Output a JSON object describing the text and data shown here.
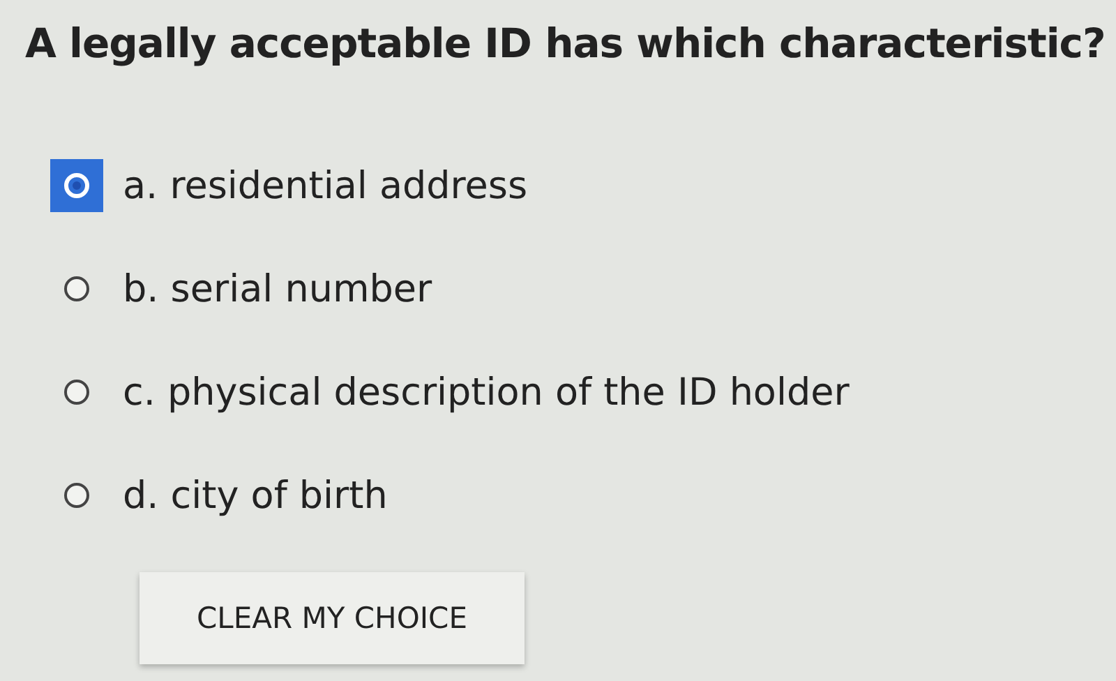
{
  "question": "A legally acceptable ID has which characteristic?",
  "options": [
    {
      "label": "a. residential address",
      "selected": true
    },
    {
      "label": "b. serial number",
      "selected": false
    },
    {
      "label": "c. physical description of the ID holder",
      "selected": false
    },
    {
      "label": "d. city of birth",
      "selected": false
    }
  ],
  "clear_button": "CLEAR MY CHOICE"
}
